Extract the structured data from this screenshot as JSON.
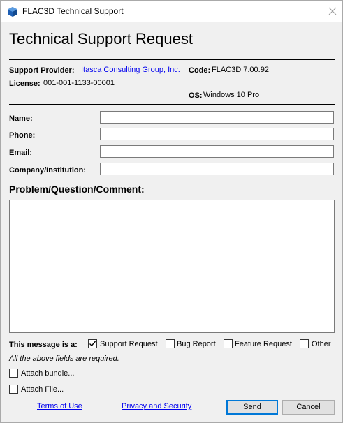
{
  "window": {
    "title": "FLAC3D Technical Support"
  },
  "header": {
    "heading": "Technical Support Request"
  },
  "info": {
    "support_provider_label": "Support Provider:",
    "support_provider_value": "Itasca Consulting Group, Inc.",
    "code_label": "Code:",
    "code_value": "FLAC3D 7.00.92",
    "license_label": "License:",
    "license_value": "001-001-1133-00001",
    "os_label": "OS:",
    "os_value": "Windows 10 Pro"
  },
  "form": {
    "name_label": "Name:",
    "name_value": "",
    "phone_label": "Phone:",
    "phone_value": "",
    "email_label": "Email:",
    "email_value": "",
    "company_label": "Company/Institution:",
    "company_value": "",
    "problem_heading": "Problem/Question/Comment:",
    "problem_value": ""
  },
  "message_type": {
    "label": "This message is a:",
    "options": [
      {
        "label": "Support Request",
        "checked": true
      },
      {
        "label": "Bug Report",
        "checked": false
      },
      {
        "label": "Feature Request",
        "checked": false
      },
      {
        "label": "Other",
        "checked": false
      }
    ]
  },
  "required_note": "All the above fields are required.",
  "attachments": {
    "bundle_label": "Attach bundle...",
    "bundle_checked": false,
    "file_label": "Attach File...",
    "file_checked": false
  },
  "footer": {
    "terms_label": "Terms of Use",
    "privacy_label": "Privacy and Security",
    "send_label": "Send",
    "cancel_label": "Cancel"
  },
  "colors": {
    "link": "#0000ee",
    "primary_button_border": "#0078d7",
    "app_icon": "#1e5fb4"
  }
}
